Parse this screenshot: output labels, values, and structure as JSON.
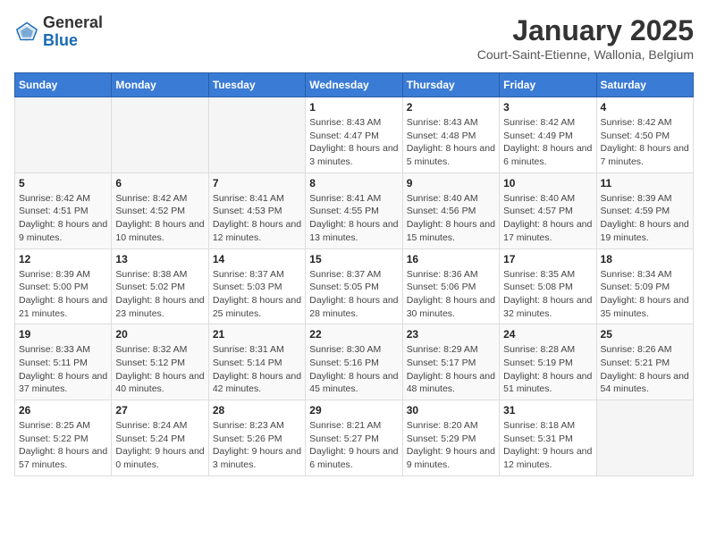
{
  "header": {
    "logo_general": "General",
    "logo_blue": "Blue",
    "title": "January 2025",
    "subtitle": "Court-Saint-Etienne, Wallonia, Belgium"
  },
  "days_of_week": [
    "Sunday",
    "Monday",
    "Tuesday",
    "Wednesday",
    "Thursday",
    "Friday",
    "Saturday"
  ],
  "weeks": [
    [
      {
        "day": "",
        "info": ""
      },
      {
        "day": "",
        "info": ""
      },
      {
        "day": "",
        "info": ""
      },
      {
        "day": "1",
        "info": "Sunrise: 8:43 AM\nSunset: 4:47 PM\nDaylight: 8 hours and 3 minutes."
      },
      {
        "day": "2",
        "info": "Sunrise: 8:43 AM\nSunset: 4:48 PM\nDaylight: 8 hours and 5 minutes."
      },
      {
        "day": "3",
        "info": "Sunrise: 8:42 AM\nSunset: 4:49 PM\nDaylight: 8 hours and 6 minutes."
      },
      {
        "day": "4",
        "info": "Sunrise: 8:42 AM\nSunset: 4:50 PM\nDaylight: 8 hours and 7 minutes."
      }
    ],
    [
      {
        "day": "5",
        "info": "Sunrise: 8:42 AM\nSunset: 4:51 PM\nDaylight: 8 hours and 9 minutes."
      },
      {
        "day": "6",
        "info": "Sunrise: 8:42 AM\nSunset: 4:52 PM\nDaylight: 8 hours and 10 minutes."
      },
      {
        "day": "7",
        "info": "Sunrise: 8:41 AM\nSunset: 4:53 PM\nDaylight: 8 hours and 12 minutes."
      },
      {
        "day": "8",
        "info": "Sunrise: 8:41 AM\nSunset: 4:55 PM\nDaylight: 8 hours and 13 minutes."
      },
      {
        "day": "9",
        "info": "Sunrise: 8:40 AM\nSunset: 4:56 PM\nDaylight: 8 hours and 15 minutes."
      },
      {
        "day": "10",
        "info": "Sunrise: 8:40 AM\nSunset: 4:57 PM\nDaylight: 8 hours and 17 minutes."
      },
      {
        "day": "11",
        "info": "Sunrise: 8:39 AM\nSunset: 4:59 PM\nDaylight: 8 hours and 19 minutes."
      }
    ],
    [
      {
        "day": "12",
        "info": "Sunrise: 8:39 AM\nSunset: 5:00 PM\nDaylight: 8 hours and 21 minutes."
      },
      {
        "day": "13",
        "info": "Sunrise: 8:38 AM\nSunset: 5:02 PM\nDaylight: 8 hours and 23 minutes."
      },
      {
        "day": "14",
        "info": "Sunrise: 8:37 AM\nSunset: 5:03 PM\nDaylight: 8 hours and 25 minutes."
      },
      {
        "day": "15",
        "info": "Sunrise: 8:37 AM\nSunset: 5:05 PM\nDaylight: 8 hours and 28 minutes."
      },
      {
        "day": "16",
        "info": "Sunrise: 8:36 AM\nSunset: 5:06 PM\nDaylight: 8 hours and 30 minutes."
      },
      {
        "day": "17",
        "info": "Sunrise: 8:35 AM\nSunset: 5:08 PM\nDaylight: 8 hours and 32 minutes."
      },
      {
        "day": "18",
        "info": "Sunrise: 8:34 AM\nSunset: 5:09 PM\nDaylight: 8 hours and 35 minutes."
      }
    ],
    [
      {
        "day": "19",
        "info": "Sunrise: 8:33 AM\nSunset: 5:11 PM\nDaylight: 8 hours and 37 minutes."
      },
      {
        "day": "20",
        "info": "Sunrise: 8:32 AM\nSunset: 5:12 PM\nDaylight: 8 hours and 40 minutes."
      },
      {
        "day": "21",
        "info": "Sunrise: 8:31 AM\nSunset: 5:14 PM\nDaylight: 8 hours and 42 minutes."
      },
      {
        "day": "22",
        "info": "Sunrise: 8:30 AM\nSunset: 5:16 PM\nDaylight: 8 hours and 45 minutes."
      },
      {
        "day": "23",
        "info": "Sunrise: 8:29 AM\nSunset: 5:17 PM\nDaylight: 8 hours and 48 minutes."
      },
      {
        "day": "24",
        "info": "Sunrise: 8:28 AM\nSunset: 5:19 PM\nDaylight: 8 hours and 51 minutes."
      },
      {
        "day": "25",
        "info": "Sunrise: 8:26 AM\nSunset: 5:21 PM\nDaylight: 8 hours and 54 minutes."
      }
    ],
    [
      {
        "day": "26",
        "info": "Sunrise: 8:25 AM\nSunset: 5:22 PM\nDaylight: 8 hours and 57 minutes."
      },
      {
        "day": "27",
        "info": "Sunrise: 8:24 AM\nSunset: 5:24 PM\nDaylight: 9 hours and 0 minutes."
      },
      {
        "day": "28",
        "info": "Sunrise: 8:23 AM\nSunset: 5:26 PM\nDaylight: 9 hours and 3 minutes."
      },
      {
        "day": "29",
        "info": "Sunrise: 8:21 AM\nSunset: 5:27 PM\nDaylight: 9 hours and 6 minutes."
      },
      {
        "day": "30",
        "info": "Sunrise: 8:20 AM\nSunset: 5:29 PM\nDaylight: 9 hours and 9 minutes."
      },
      {
        "day": "31",
        "info": "Sunrise: 8:18 AM\nSunset: 5:31 PM\nDaylight: 9 hours and 12 minutes."
      },
      {
        "day": "",
        "info": ""
      }
    ]
  ]
}
